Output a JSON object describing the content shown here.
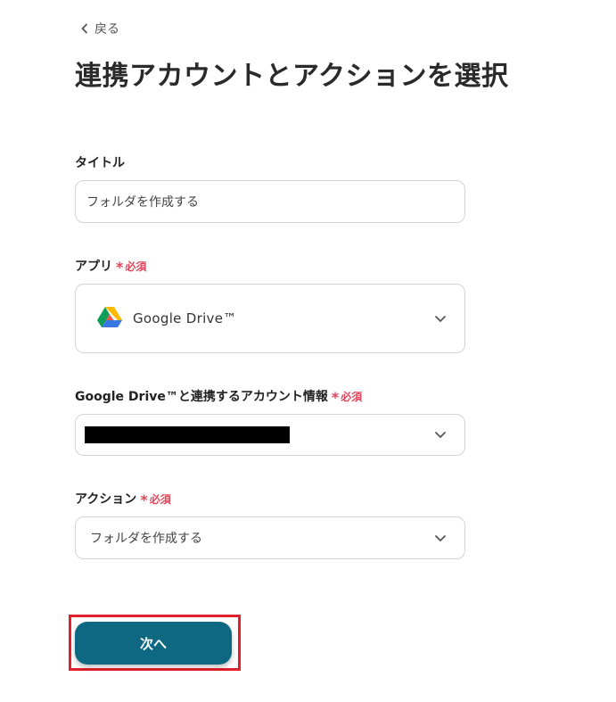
{
  "header": {
    "back_label": "戻る",
    "title": "連携アカウントとアクションを選択"
  },
  "form": {
    "title_field": {
      "label": "タイトル",
      "value": "フォルダを作成する"
    },
    "app_field": {
      "label": "アプリ",
      "required_label": "必須",
      "value": "Google Drive™",
      "icon": "google-drive-icon"
    },
    "account_field": {
      "label": "Google Drive™と連携するアカウント情報",
      "required_label": "必須"
    },
    "action_field": {
      "label": "アクション",
      "required_label": "必須",
      "value": "フォルダを作成する"
    }
  },
  "footer": {
    "next_label": "次へ"
  },
  "colors": {
    "primary_button": "#0e6882",
    "required": "#e0455a",
    "highlight": "#e0202a"
  }
}
